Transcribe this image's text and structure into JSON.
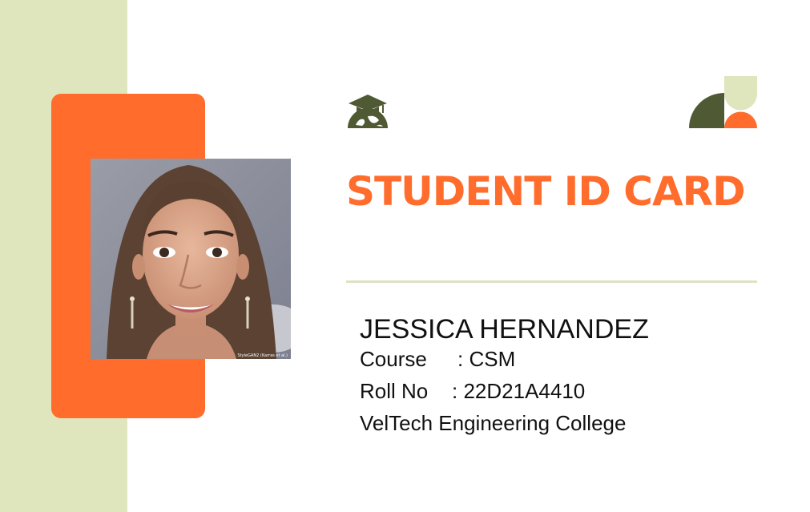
{
  "card": {
    "title": "STUDENT ID CARD",
    "student": {
      "name": "JESSICA HERNANDEZ",
      "course_label": "Course",
      "course_value": ": CSM",
      "roll_label": "Roll No",
      "roll_value": ": 22D21A4410",
      "college": "VelTech Engineering College"
    },
    "photo": {
      "credit": "StyleGAN2 (Karras et al.)"
    }
  },
  "colors": {
    "accent_orange": "#FF6C2C",
    "sage_light": "#DFE6BE",
    "olive_dark": "#4F5A34",
    "divider": "#DCE3C4",
    "background": "#FFFFFF"
  },
  "icons": {
    "logo": "graduation-cap-globe-icon",
    "decoration": "geometric-shapes-icon"
  }
}
